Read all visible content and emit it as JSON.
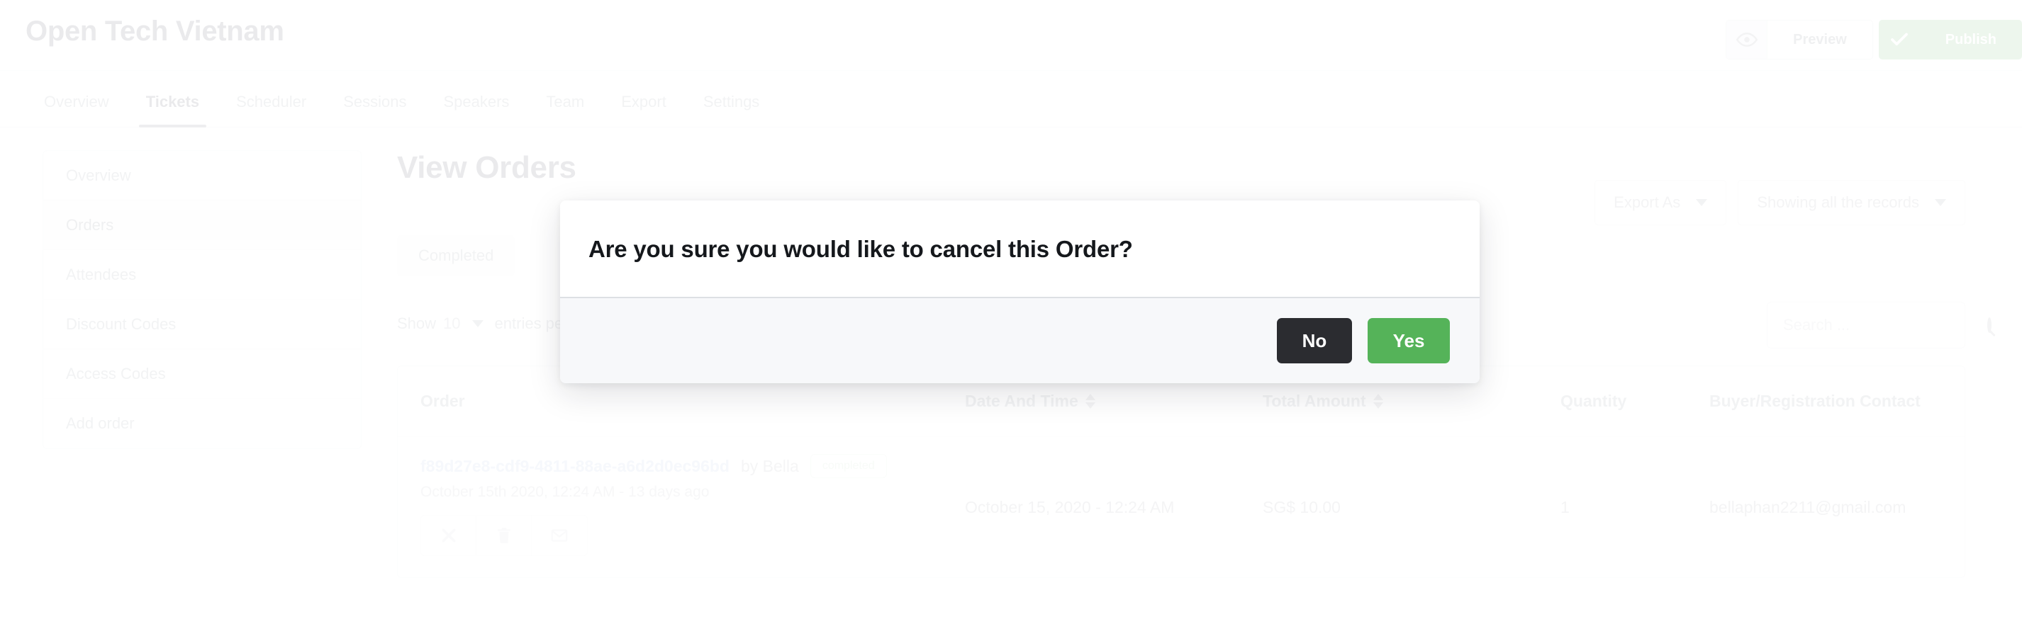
{
  "header": {
    "event_title": "Open Tech Vietnam",
    "preview_label": "Preview",
    "preview_icon": "eye-icon",
    "publish_label": "Publish",
    "publish_icon": "check-icon",
    "publish_color": "#4fb153"
  },
  "tabs": [
    {
      "label": "Overview",
      "active": false
    },
    {
      "label": "Tickets",
      "active": true
    },
    {
      "label": "Scheduler",
      "active": false
    },
    {
      "label": "Sessions",
      "active": false
    },
    {
      "label": "Speakers",
      "active": false
    },
    {
      "label": "Team",
      "active": false
    },
    {
      "label": "Export",
      "active": false
    },
    {
      "label": "Settings",
      "active": false
    }
  ],
  "sidebar": {
    "items": [
      {
        "label": "Overview",
        "active": false
      },
      {
        "label": "Orders",
        "active": true
      },
      {
        "label": "Attendees",
        "active": false
      },
      {
        "label": "Discount Codes",
        "active": false
      },
      {
        "label": "Access Codes",
        "active": false
      },
      {
        "label": "Add order",
        "active": false
      }
    ]
  },
  "main": {
    "page_title": "View Orders",
    "export_as_label": "Export As",
    "records_filter_label": "Showing all the records",
    "status_chip": "Completed",
    "show_prefix": "Show",
    "show_count": "10",
    "show_suffix": "entries per page",
    "search_placeholder": "Search ...",
    "search_value": ""
  },
  "table": {
    "columns": [
      {
        "label": "Order",
        "sortable": false
      },
      {
        "label": "Date And Time",
        "sortable": true
      },
      {
        "label": "Total Amount",
        "sortable": true
      },
      {
        "label": "Quantity",
        "sortable": false
      },
      {
        "label": "Buyer/Registration Contact",
        "sortable": false
      }
    ],
    "rows": [
      {
        "order_id": "f89d27e8-cdf9-4811-88ae-a6d2d0ec96bd",
        "order_by": "by Bella",
        "status_badge": "completed",
        "order_subtext": "October 15th 2020, 12:24 AM - 13 days ago",
        "actions": [
          {
            "icon": "cancel-x-icon",
            "name": "cancel-order-button"
          },
          {
            "icon": "trash-icon",
            "name": "delete-order-button"
          },
          {
            "icon": "envelope-icon",
            "name": "resend-email-button"
          }
        ],
        "date_and_time": "October 15, 2020 - 12:24 AM",
        "total_amount": "SG$ 10.00",
        "quantity": "1",
        "buyer_contact": "bellaphan2211@gmail.com"
      }
    ]
  },
  "modal": {
    "title": "Are you sure you would like to cancel this Order?",
    "no_label": "No",
    "yes_label": "Yes",
    "no_color": "#2b2c30",
    "yes_color": "#55b359"
  }
}
